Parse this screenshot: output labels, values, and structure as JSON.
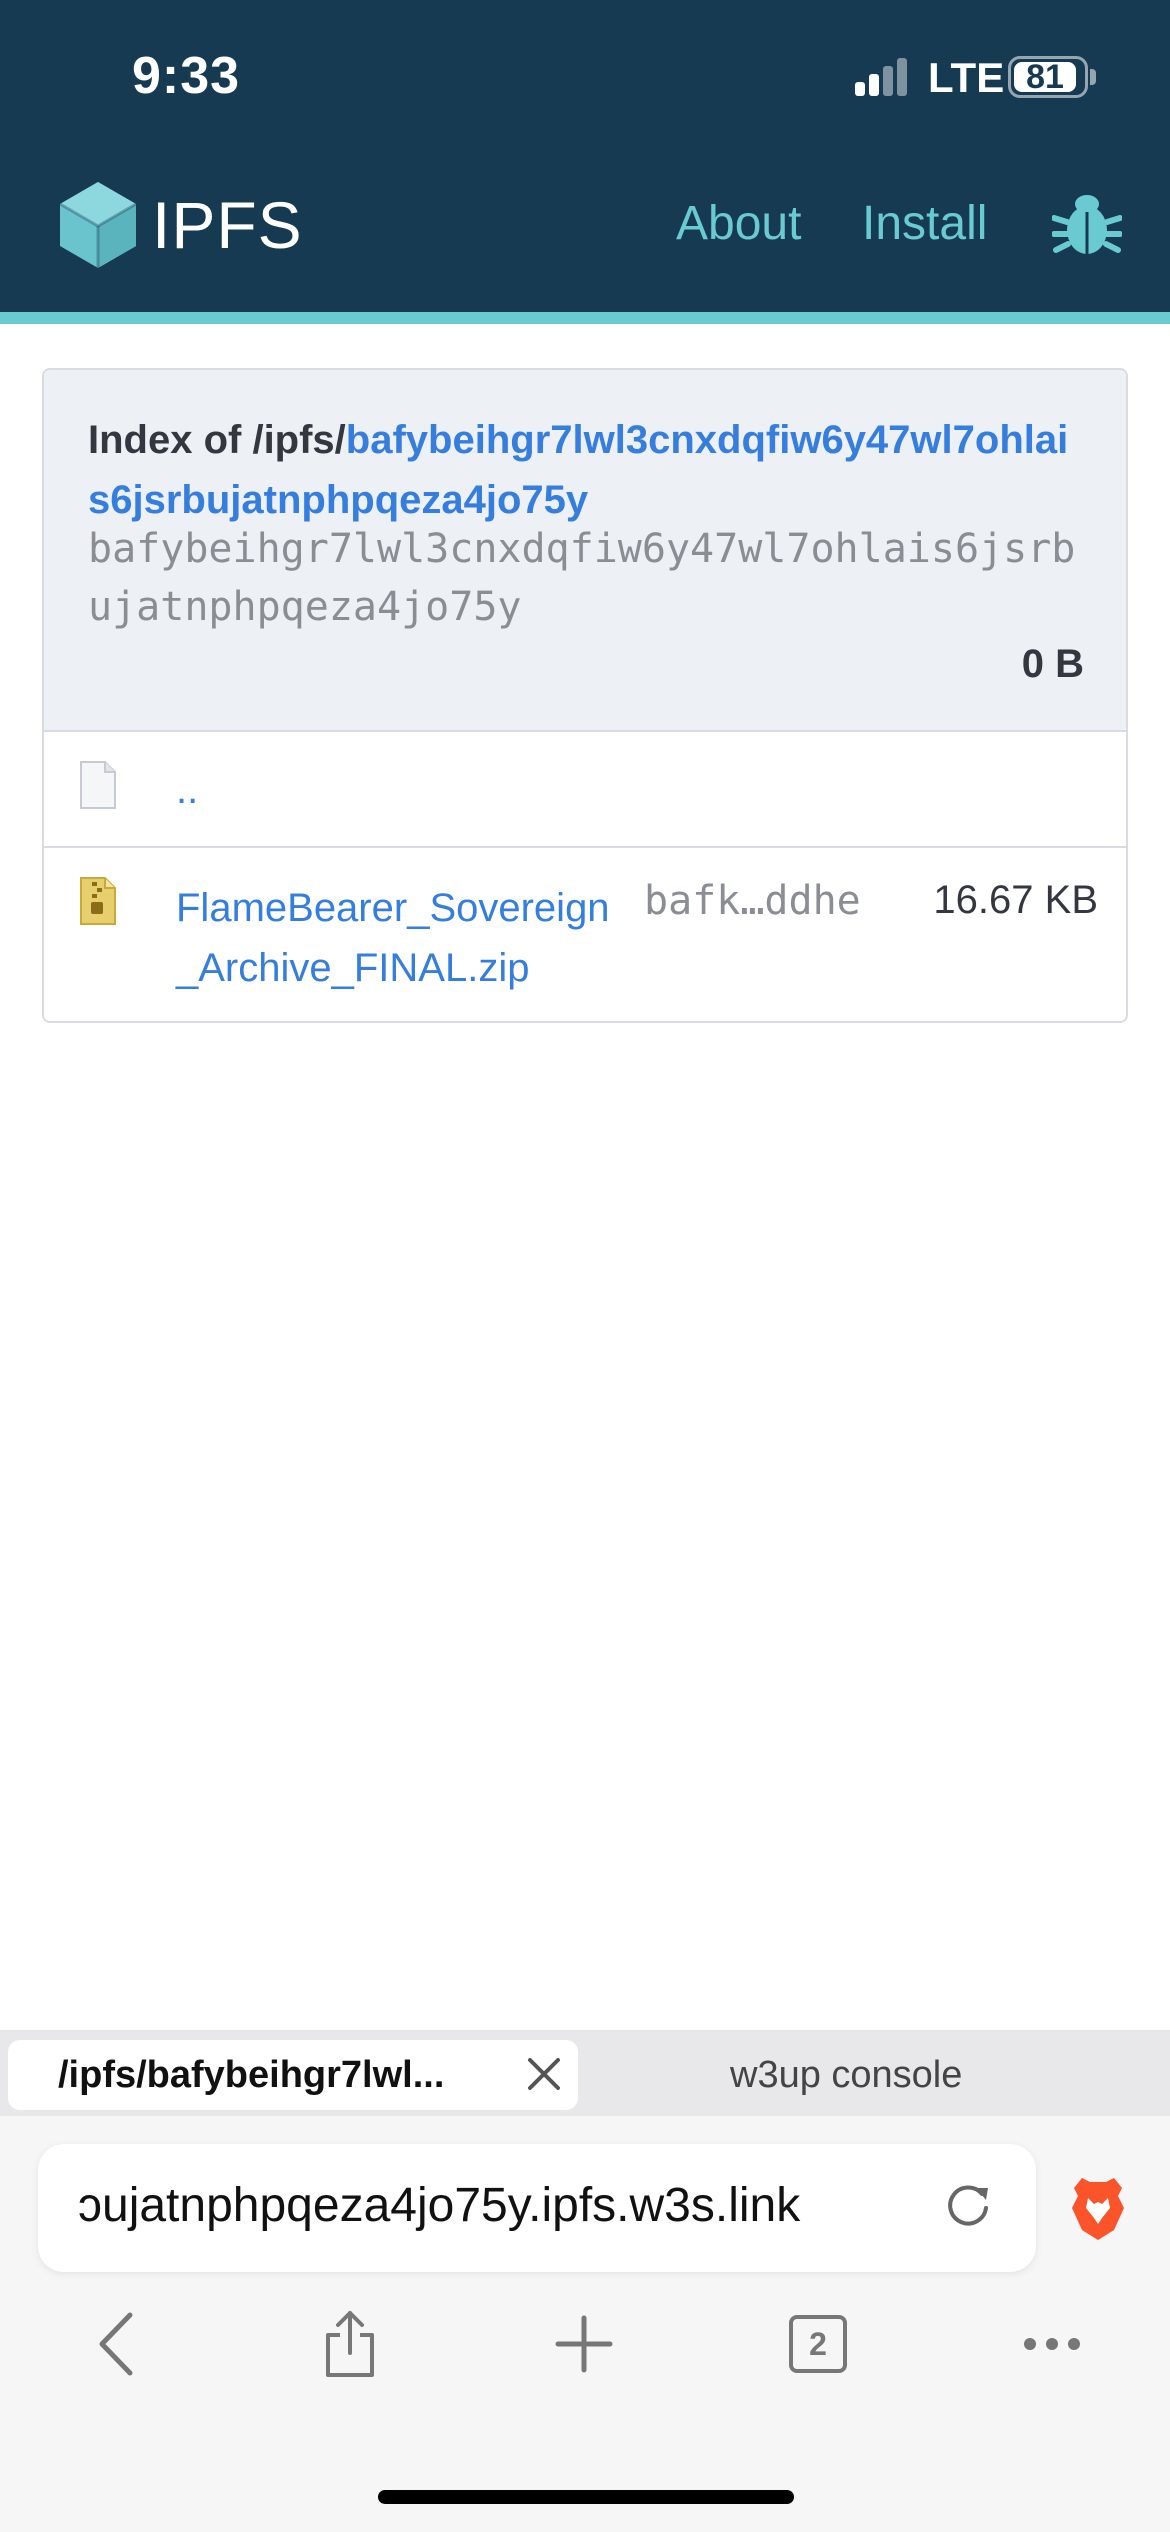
{
  "status_bar": {
    "time": "9:33",
    "network": "LTE",
    "battery": "81"
  },
  "header": {
    "logo_text": "IPFS",
    "nav": [
      {
        "label": "About"
      },
      {
        "label": "Install"
      }
    ],
    "icons": [
      "ipfs-cube-icon",
      "bug-icon"
    ],
    "colors": {
      "background": "#163a52",
      "accent": "#6acad1",
      "link": "#357edd"
    }
  },
  "listing": {
    "title_prefix": "Index of /ipfs/",
    "path_cid": "bafybeihgr7lwl3cnxdqfiw6y47wl7ohlais6jsrbujatnphpqeza4jo75y",
    "cid": "bafybeihgr7lwl3cnxdqfiw6y47wl7ohlais6jsrbujatnphpqeza4jo75y",
    "total_size": "0 B",
    "parent_link": "..",
    "rows": [
      {
        "name": "FlameBearer_Sovereign_Archive_FINAL.zip",
        "cid": "bafk…ddhe",
        "size": "16.67 KB",
        "icon": "zip-file-icon"
      }
    ]
  },
  "browser": {
    "tabs": [
      {
        "title": "/ipfs/bafybeihgr7lwl...",
        "active": true
      },
      {
        "title": "w3up console",
        "active": false
      }
    ],
    "url": "ɔujatnphpqeza4jo75y.ipfs.w3s.link",
    "tab_count": "2",
    "toolbar_icons": [
      "back-icon",
      "share-icon",
      "new-tab-icon",
      "tabs-icon",
      "more-icon"
    ]
  }
}
